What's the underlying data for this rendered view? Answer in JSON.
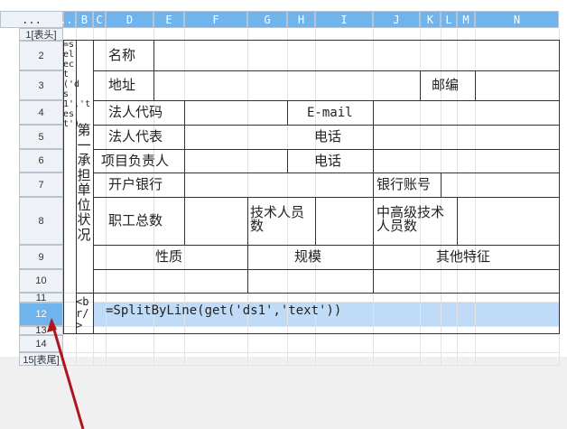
{
  "grid": {
    "corner_label": "...",
    "columns": [
      "B",
      "C",
      "D",
      "E",
      "F",
      "G",
      "H",
      "I",
      "J",
      "K",
      "L",
      "M",
      "N"
    ],
    "rows": [
      "1[表头]",
      "2",
      "3",
      "4",
      "5",
      "6",
      "7",
      "8",
      "9",
      "10",
      "11",
      "12",
      "13",
      "14",
      "15[表尾]"
    ],
    "selected_row": "12"
  },
  "cells": {
    "name": "名称",
    "address": "地址",
    "postcode": "邮编",
    "legal_code": "法人代码",
    "email": "E-mail",
    "legal_rep": "法人代表",
    "phone1": "电话",
    "project_lead": "项目负责人",
    "phone2": "电话",
    "bank": "开户银行",
    "bank_account": "银行账号",
    "total_staff": "职工总数",
    "tech_staff": "技术人员数",
    "senior_staff": "中高级技术人员数",
    "nature": "性质",
    "scale": "规模",
    "other": "其他特征",
    "vertical_expr": "=select('ds1','test')",
    "section_label": "第一承担单位状况",
    "br_tag": "<br/>",
    "formula": "=SplitByLine(get('ds1','text'))"
  },
  "colors": {
    "selected_header": "#6fb4ec",
    "selected_cell": "#bfdbf7",
    "arrow": "#b0141c"
  }
}
